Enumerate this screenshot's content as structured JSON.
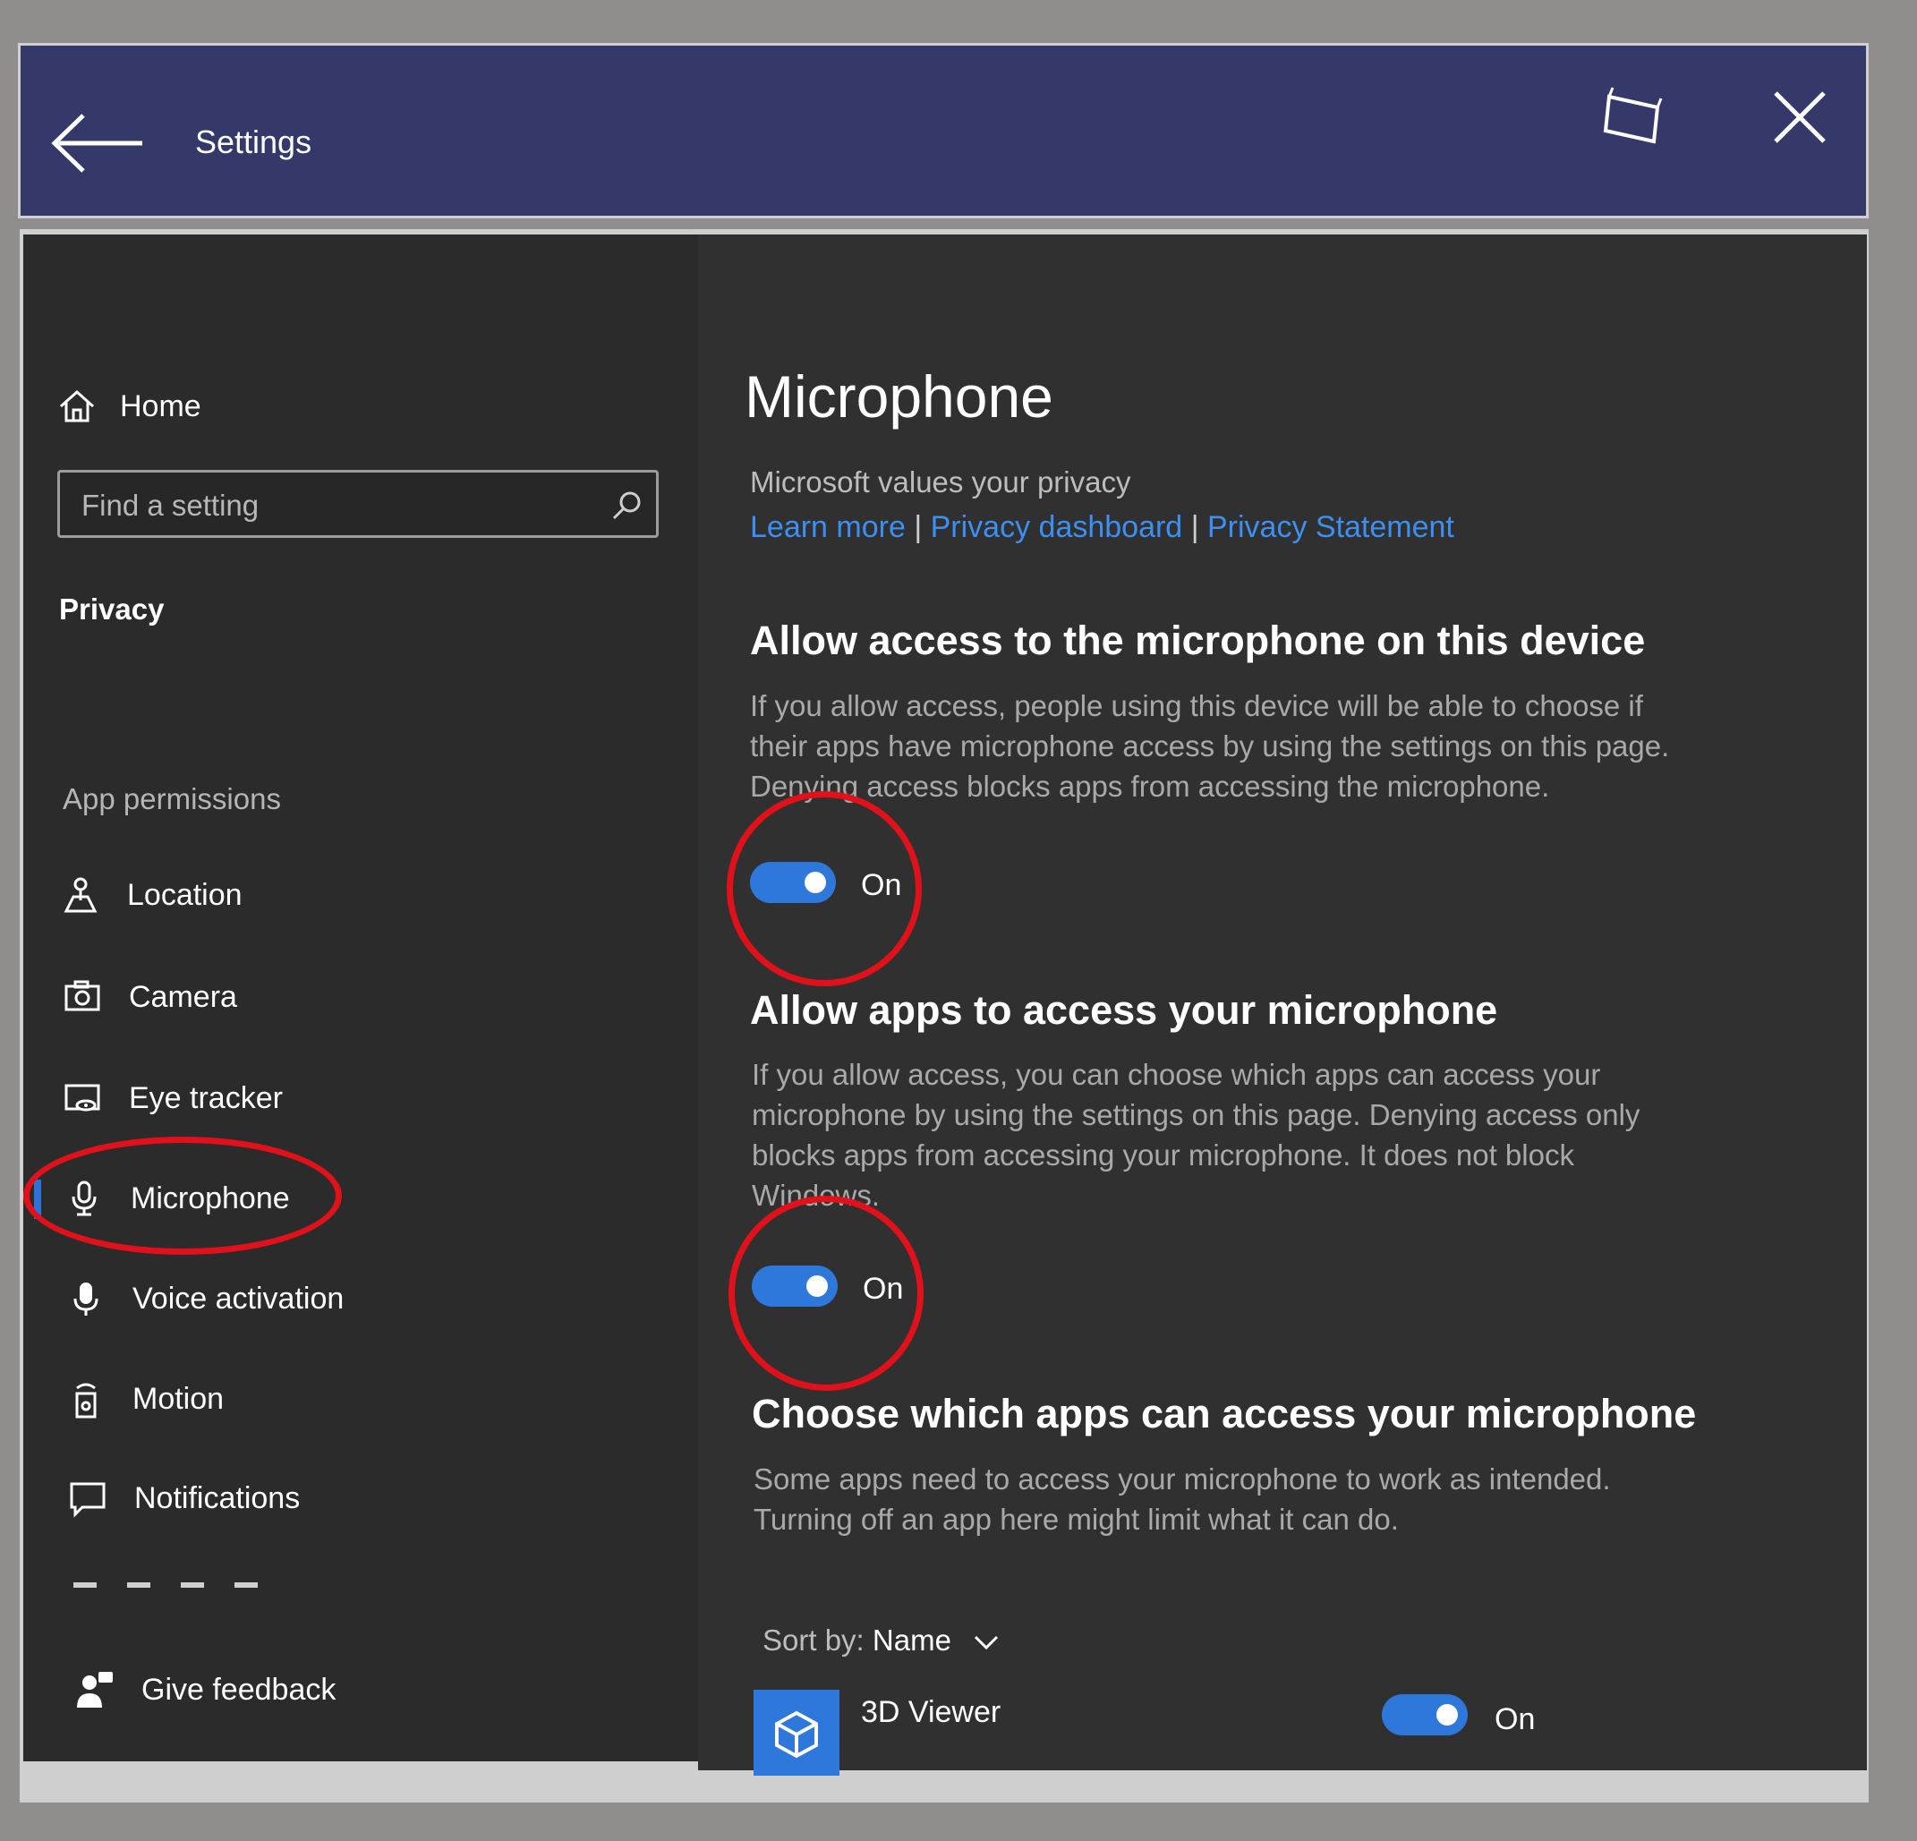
{
  "window": {
    "title": "Settings",
    "back_icon": "arrow-left-icon",
    "window_icon": "window-mode-icon",
    "close_icon": "close-icon"
  },
  "sidebar": {
    "home_label": "Home",
    "search_placeholder": "Find a setting",
    "section_title": "Privacy",
    "app_permissions_label": "App permissions",
    "items": [
      {
        "label": "Location",
        "icon": "location-icon"
      },
      {
        "label": "Camera",
        "icon": "camera-icon"
      },
      {
        "label": "Eye tracker",
        "icon": "eye-tracker-icon"
      },
      {
        "label": "Microphone",
        "icon": "microphone-icon",
        "selected": true
      },
      {
        "label": "Voice activation",
        "icon": "voice-activation-icon"
      },
      {
        "label": "Motion",
        "icon": "motion-icon"
      },
      {
        "label": "Notifications",
        "icon": "notifications-icon"
      }
    ],
    "feedback_label": "Give feedback"
  },
  "content": {
    "title": "Microphone",
    "privacy_intro": "Microsoft values your privacy",
    "links": [
      "Learn more",
      "Privacy dashboard",
      "Privacy Statement"
    ],
    "link_separator": "|",
    "section1": {
      "heading": "Allow access to the microphone on this device",
      "lines": [
        "If you allow access, people using this device will be able to choose if",
        "their apps have microphone access by using the settings on this page.",
        "Denying access blocks apps from accessing the microphone."
      ],
      "toggle_state": "On"
    },
    "section2": {
      "heading": "Allow apps to access your microphone",
      "lines": [
        "If you allow access, you can choose which apps can access your",
        "microphone by using the settings on this page. Denying access only",
        "blocks apps from accessing your microphone. It does not block",
        "Windows."
      ],
      "toggle_state": "On"
    },
    "section3": {
      "heading": "Choose which apps can access your microphone",
      "lines": [
        "Some apps need to access your microphone to work as intended.",
        "Turning off an app here might limit what it can do."
      ]
    },
    "sort": {
      "label": "Sort by:",
      "value": "Name"
    },
    "apps": [
      {
        "name": "3D Viewer",
        "toggle_state": "On",
        "icon": "3d-viewer-icon"
      }
    ]
  },
  "colors": {
    "titlebar": "#343969",
    "accent": "#2f78db",
    "link": "#3d8ff2",
    "annotation": "#e0111a"
  }
}
